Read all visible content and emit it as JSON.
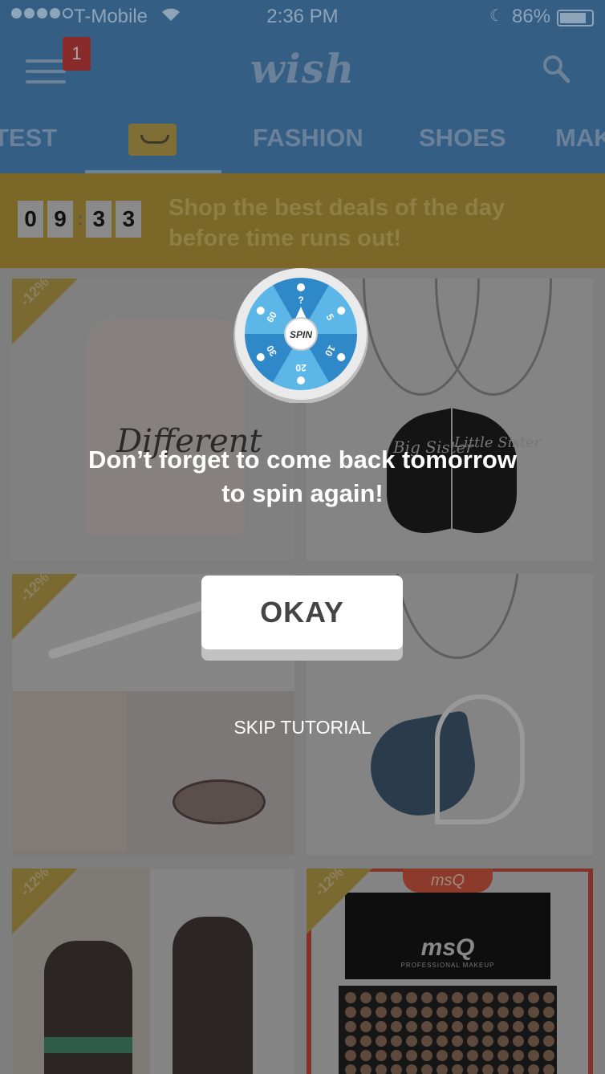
{
  "status_bar": {
    "carrier": "T-Mobile",
    "time": "2:36 PM",
    "battery": "86%",
    "wifi_icon": "wifi-icon",
    "battery_icon": "battery-icon"
  },
  "header": {
    "logo": "wish",
    "notification_count": "1",
    "menu_icon": "hamburger-menu-icon",
    "search_icon": "search-icon"
  },
  "tabs": [
    {
      "label": "TEST"
    },
    {
      "label": "",
      "icon": "shopping-bag-icon",
      "selected": true
    },
    {
      "label": "FASHION"
    },
    {
      "label": "SHOES"
    },
    {
      "label": "MAK"
    }
  ],
  "deal_banner": {
    "timer_digits": [
      "0",
      "9",
      "3",
      "3"
    ],
    "message": "Shop the best deals of the day before time runs out!"
  },
  "products": [
    {
      "discount": "-12%",
      "image_text": "Different"
    },
    {
      "image_text_1": "Big Sister",
      "image_text_2": "Little Sister"
    },
    {
      "discount": "-12%"
    },
    {},
    {
      "discount": "-12%"
    },
    {
      "discount": "-12%",
      "image_text": "msQ",
      "image_subtext": "PROFESSIONAL MAKEUP",
      "image_cap_text": "msQ"
    }
  ],
  "wheel": {
    "center_label": "SPIN",
    "segments": [
      "?",
      "5",
      "10",
      "20",
      "30",
      "60"
    ],
    "colors": {
      "light": "#5cb7e8",
      "dark": "#2f88c8",
      "rim": "#eaeaea"
    }
  },
  "tutorial": {
    "message_line_1": "Don’t forget to come back tomorrow",
    "message_line_2": "to spin again!",
    "okay_label": "OKAY",
    "skip_label": "SKIP TUTORIAL"
  }
}
